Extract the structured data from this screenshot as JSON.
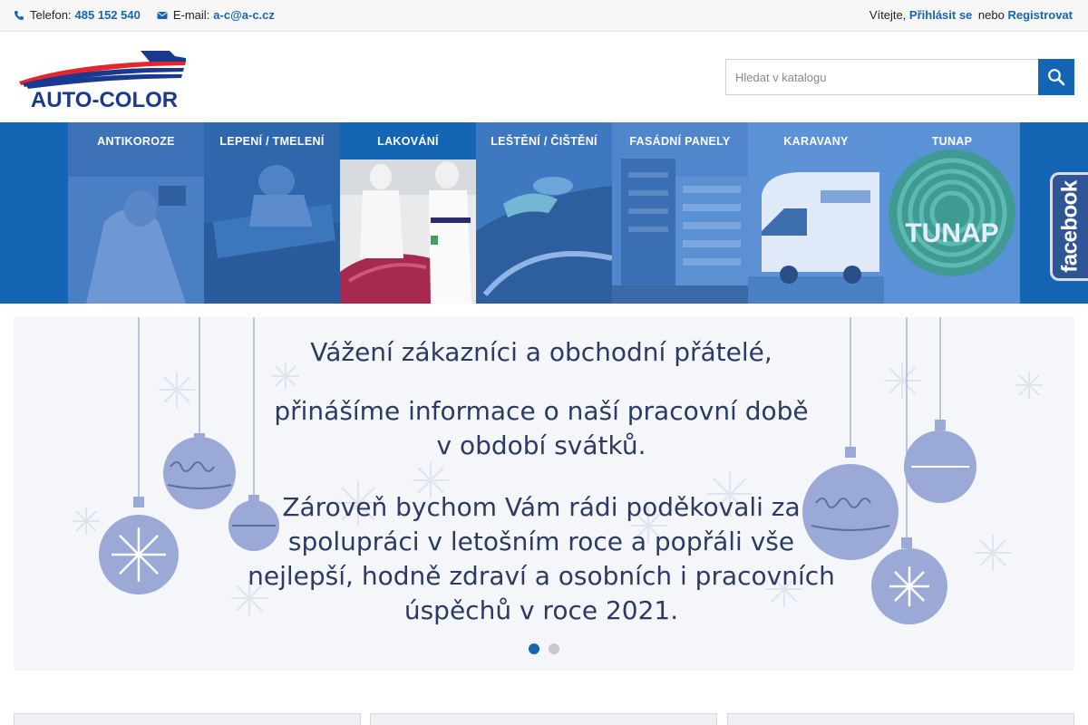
{
  "topbar": {
    "phone_label": "Telefon:",
    "phone_value": "485 152 540",
    "email_label": "E-mail:",
    "email_value": "a-c@a-c.cz",
    "welcome": "Vítejte,",
    "login": "Přihlásit se",
    "or": "nebo",
    "register": "Registrovat"
  },
  "header": {
    "logo_text": "AUTO-COLOR",
    "search_placeholder": "Hledat v katalogu"
  },
  "categories": [
    {
      "label": "ANTIKOROZE"
    },
    {
      "label": "LEPENÍ / TMELENÍ"
    },
    {
      "label": "LAKOVÁNÍ"
    },
    {
      "label": "LEŠTĚNÍ / ČIŠTĚNÍ"
    },
    {
      "label": "FASÁDNÍ PANELY"
    },
    {
      "label": "KARAVANY"
    },
    {
      "label": "TUNAP"
    }
  ],
  "tunap_logo_text": "TUNAP",
  "facebook_text": "facebook",
  "slide": {
    "line1": "Vážení zákazníci a obchodní přátelé,",
    "line2a": "přinášíme informace o naší pracovní době",
    "line2b": "v období svátků.",
    "line3a": "Zároveň bychom Vám rádi poděkovali za",
    "line3b": "spolupráci v letošním roce a popřáli vše",
    "line3c": "nejlepší, hodně zdraví a osobních i pracovních",
    "line3d": "úspěchů v roce 2021."
  },
  "colors": {
    "brand_blue": "#1565b5",
    "logo_red": "#e3262d",
    "logo_navy": "#1a3a8f",
    "slide_text": "#2b3b63",
    "ornament": "#9aa9d6"
  },
  "icons": {
    "phone": "phone-icon",
    "email": "envelope-icon",
    "search": "search-icon"
  }
}
